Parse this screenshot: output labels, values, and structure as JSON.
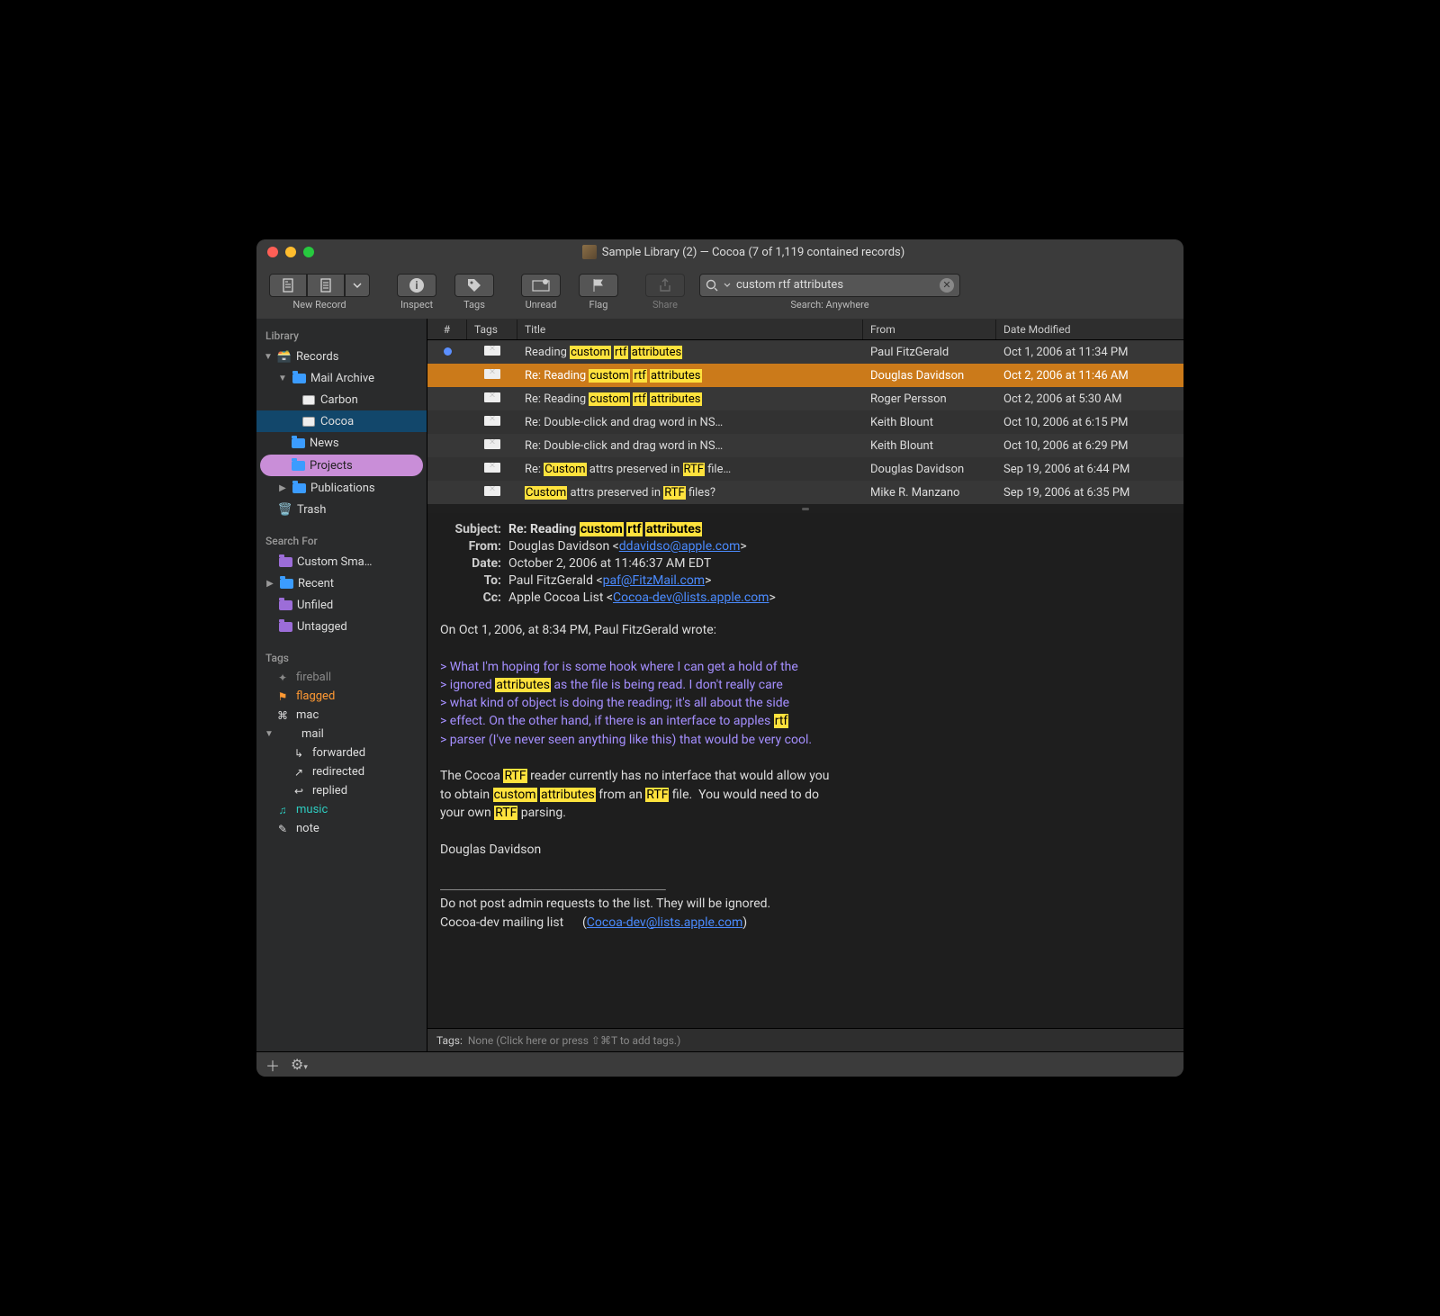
{
  "window": {
    "title": "Sample Library (2) — Cocoa (7 of 1,119 contained records)"
  },
  "toolbar": {
    "new_record": "New Record",
    "inspect": "Inspect",
    "tags": "Tags",
    "unread": "Unread",
    "flag": "Flag",
    "share": "Share",
    "search_label": "Search: Anywhere",
    "search_value": "custom rtf attributes"
  },
  "sidebar": {
    "library_header": "Library",
    "records": "Records",
    "mail_archive": "Mail Archive",
    "carbon": "Carbon",
    "cocoa": "Cocoa",
    "news": "News",
    "projects": "Projects",
    "publications": "Publications",
    "trash": "Trash",
    "searchfor_header": "Search For",
    "custom_smart": "Custom Sma…",
    "recent": "Recent",
    "unfiled": "Unfiled",
    "untagged": "Untagged",
    "tags_header": "Tags",
    "tags": {
      "fireball": "fireball",
      "flagged": "flagged",
      "mac": "mac",
      "mail": "mail",
      "forwarded": "forwarded",
      "redirected": "redirected",
      "replied": "replied",
      "music": "music",
      "note": "note"
    }
  },
  "list": {
    "headers": {
      "num": "#",
      "tags": "Tags",
      "title": "Title",
      "from": "From",
      "date": "Date Modified"
    },
    "rows": [
      {
        "unread": true,
        "title_pre": "Reading ",
        "hls": [
          "custom",
          "rtf",
          "attributes"
        ],
        "title_post": "",
        "from": "Paul FitzGerald",
        "date": "Oct 1, 2006 at 11:34 PM",
        "selected": false
      },
      {
        "unread": false,
        "title_pre": "Re: Reading ",
        "hls": [
          "custom",
          "rtf",
          "attributes"
        ],
        "title_post": "",
        "from": "Douglas Davidson",
        "date": "Oct 2, 2006 at 11:46 AM",
        "selected": true
      },
      {
        "unread": false,
        "title_pre": "Re: Reading ",
        "hls": [
          "custom",
          "rtf",
          "attributes"
        ],
        "title_post": "",
        "from": "Roger Persson",
        "date": "Oct 2, 2006 at 5:30 AM",
        "selected": false
      },
      {
        "unread": false,
        "title_pre": "Re: Double-click and drag word in NS…",
        "hls": [],
        "title_post": "",
        "from": "Keith Blount",
        "date": "Oct 10, 2006 at 6:15 PM",
        "selected": false
      },
      {
        "unread": false,
        "title_pre": "Re: Double-click and drag word in NS…",
        "hls": [],
        "title_post": "",
        "from": "Keith Blount",
        "date": "Oct 10, 2006 at 6:29 PM",
        "selected": false
      },
      {
        "unread": false,
        "title_pre": "Re: ",
        "hls": [
          "Custom"
        ],
        "title_mid": " attrs preserved in ",
        "hls2": [
          "RTF"
        ],
        "title_post": " file…",
        "from": "Douglas Davidson",
        "date": "Sep 19, 2006 at 6:44 PM",
        "selected": false
      },
      {
        "unread": false,
        "title_pre": "",
        "hls": [
          "Custom"
        ],
        "title_mid": " attrs preserved in ",
        "hls2": [
          "RTF"
        ],
        "title_post": " files?",
        "from": "Mike R. Manzano",
        "date": "Sep 19, 2006 at 6:35 PM",
        "selected": false
      }
    ]
  },
  "detail": {
    "subject_label": "Subject:",
    "subject_pre": "Re: Reading ",
    "subject_hls": [
      "custom",
      "rtf",
      "attributes"
    ],
    "from_label": "From:",
    "from_name": "Douglas Davidson <",
    "from_email": "ddavidso@apple.com",
    "from_close": ">",
    "date_label": "Date:",
    "date_value": "October 2, 2006 at 11:46:37 AM EDT",
    "to_label": "To:",
    "to_name": "Paul FitzGerald <",
    "to_email": "paf@FitzMail.com",
    "to_close": ">",
    "cc_label": "Cc:",
    "cc_name": "Apple Cocoa List <",
    "cc_email": "Cocoa-dev@lists.apple.com",
    "cc_close": ">",
    "body_intro": "On Oct 1, 2006, at 8:34 PM, Paul FitzGerald wrote:",
    "q1a": "> What I'm hoping for is some hook where I can get a hold of the",
    "q2a": "> ignored ",
    "q2hl": "attributes",
    "q2b": " as the file is being read. I don't really care",
    "q3": "> what kind of object is doing the reading; it's all about the side",
    "q4a": "> effect. On the other hand, if there is an interface to apples ",
    "q4hl": "rtf",
    "q5": "> parser (I've never seen anything like this) that would be very cool.",
    "body1a": "The Cocoa ",
    "body1hl1": "RTF",
    "body1b": " reader currently has no interface that would allow you",
    "body2a": "to obtain ",
    "body2hl1": "custom",
    "body2b": " ",
    "body2hl2": "attributes",
    "body2c": " from an ",
    "body2hl3": "RTF",
    "body2d": " file.  You would need to do",
    "body3a": "your own ",
    "body3hl": "RTF",
    "body3b": " parsing.",
    "sig_name": "Douglas Davidson",
    "sig_sep": "_______________________________________________",
    "footer1": "Do not post admin requests to the list. They will be ignored.",
    "footer2a": "Cocoa-dev mailing list      (",
    "footer2link": "Cocoa-dev@lists.apple.com",
    "footer2b": ")"
  },
  "tagbar": {
    "label": "Tags:",
    "placeholder": "None (Click here or press ⇧⌘T to add tags.)"
  }
}
